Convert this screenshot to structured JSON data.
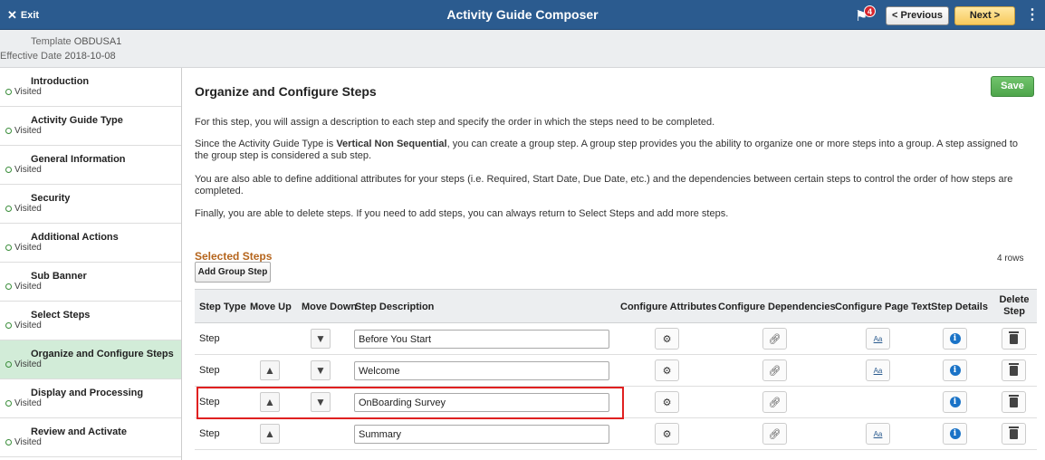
{
  "header": {
    "exit_label": "Exit",
    "title": "Activity Guide Composer",
    "notification_count": "4",
    "prev_label": "< Previous",
    "next_label": "Next >"
  },
  "info": {
    "template_label": "Template",
    "template_value": "OBDUSA1",
    "date_label": "Effective Date",
    "date_value": "2018-10-08"
  },
  "sidebar": {
    "items": [
      {
        "label": "Introduction",
        "status": "Visited",
        "active": false
      },
      {
        "label": "Activity Guide Type",
        "status": "Visited",
        "active": false
      },
      {
        "label": "General Information",
        "status": "Visited",
        "active": false
      },
      {
        "label": "Security",
        "status": "Visited",
        "active": false
      },
      {
        "label": "Additional Actions",
        "status": "Visited",
        "active": false
      },
      {
        "label": "Sub Banner",
        "status": "Visited",
        "active": false
      },
      {
        "label": "Select Steps",
        "status": "Visited",
        "active": false
      },
      {
        "label": "Organize and Configure Steps",
        "status": "Visited",
        "active": true
      },
      {
        "label": "Display and Processing",
        "status": "Visited",
        "active": false
      },
      {
        "label": "Review and Activate",
        "status": "Visited",
        "active": false
      }
    ]
  },
  "main": {
    "title": "Organize and Configure Steps",
    "save_label": "Save",
    "para1": "For this step, you will assign a description to each step and specify the order in which the steps need to be completed.",
    "para2_pre": "Since the Activity Guide Type is ",
    "para2_bold": "Vertical Non Sequential",
    "para2_post": ", you can create a group step. A group step provides you the ability to organize one or more steps into a group. A step assigned to the group step is considered a sub step.",
    "para3": "You are also able to define additional attributes for your steps (i.e. Required, Start Date, Due Date, etc.) and the dependencies between certain steps to control the order of how steps are completed.",
    "para4": "Finally, you are able to delete steps. If you need to add steps, you can always return to Select Steps and add more steps.",
    "selected_steps_title": "Selected Steps",
    "rows_count": "4 rows",
    "add_group_step_label": "Add Group Step"
  },
  "table": {
    "headers": {
      "step_type": "Step Type",
      "move_up": "Move Up",
      "move_down": "Move Down",
      "step_description": "Step Description",
      "configure_attributes": "Configure Attributes",
      "configure_dependencies": "Configure Dependencies",
      "configure_page_text": "Configure Page Text",
      "step_details": "Step Details",
      "delete_step_1": "Delete",
      "delete_step_2": "Step"
    },
    "rows": [
      {
        "type": "Step",
        "description": "Before You Start",
        "move_up": false,
        "move_down": true,
        "page_text": true
      },
      {
        "type": "Step",
        "description": "Welcome",
        "move_up": true,
        "move_down": true,
        "page_text": true
      },
      {
        "type": "Step",
        "description": "OnBoarding Survey",
        "move_up": true,
        "move_down": true,
        "page_text": false
      },
      {
        "type": "Step",
        "description": "Summary",
        "move_up": true,
        "move_down": false,
        "page_text": true
      }
    ]
  },
  "colors": {
    "header_bg": "#2b5b8f",
    "active_nav_bg": "#d2ecd8",
    "save_green": "#4ea54b",
    "section_title": "#b5651d",
    "highlight": "#e02020"
  }
}
